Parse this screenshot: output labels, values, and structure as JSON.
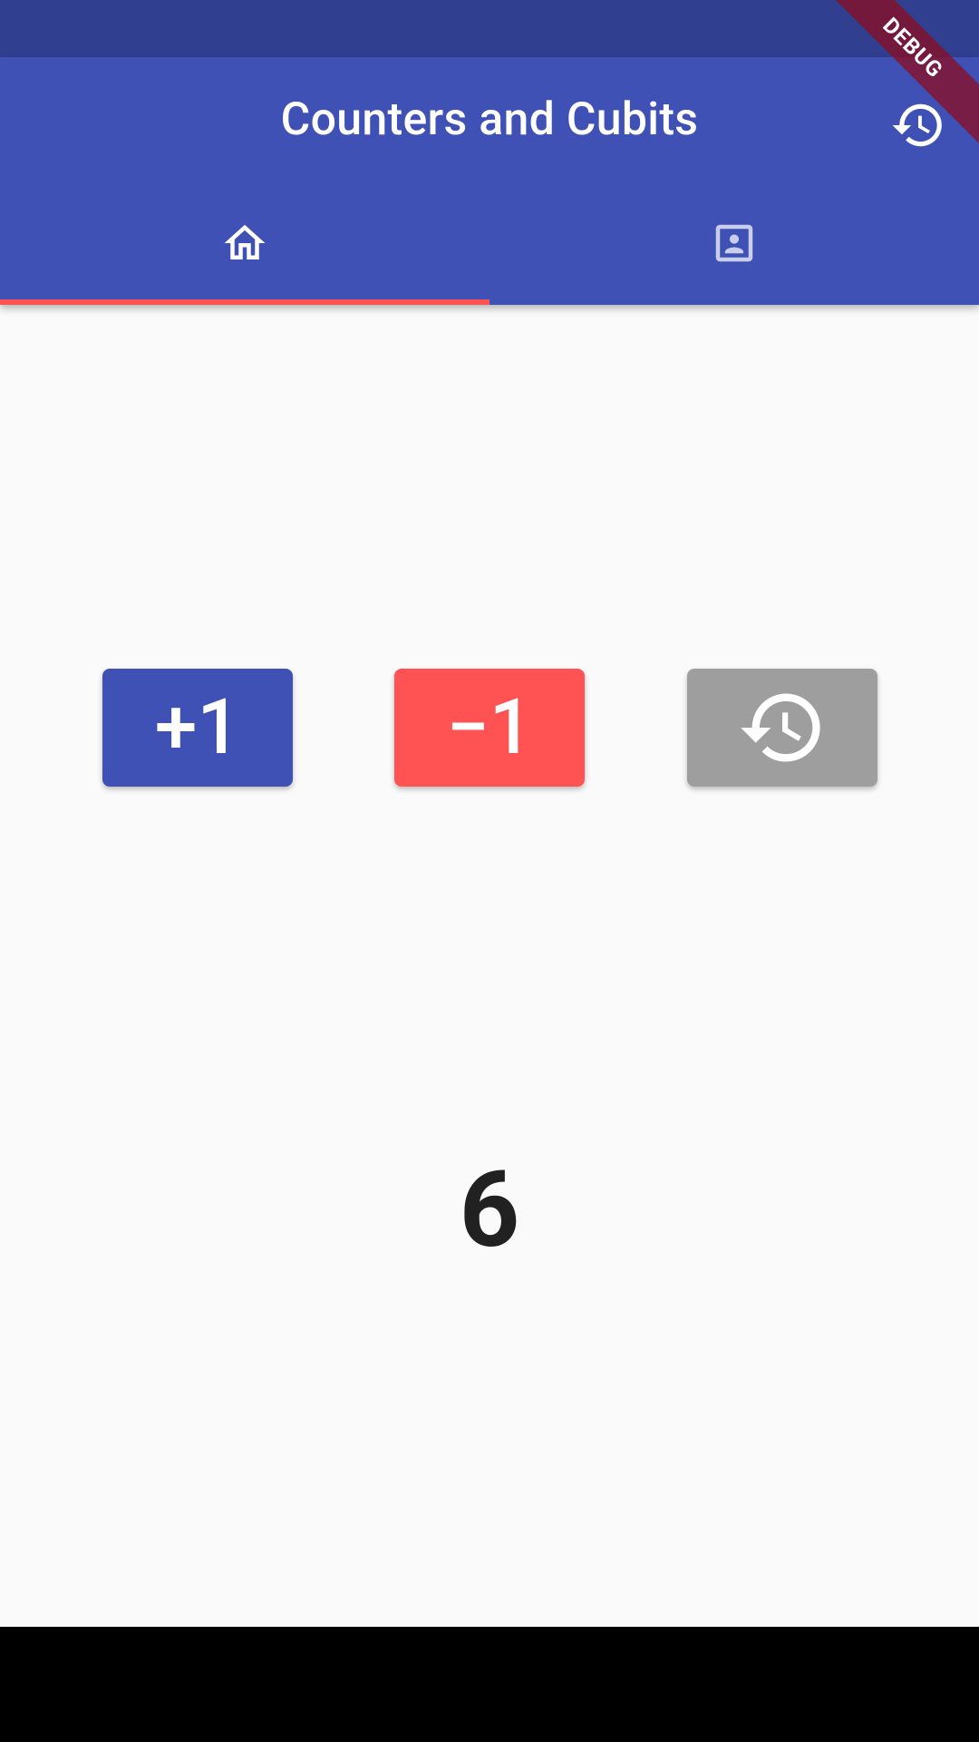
{
  "app_bar": {
    "title": "Counters and Cubits",
    "action_icon": "history-icon"
  },
  "tabs": [
    {
      "icon": "home-icon",
      "selected": true
    },
    {
      "icon": "portrait-icon",
      "selected": false
    }
  ],
  "buttons": {
    "increment": {
      "label": "+1",
      "color": "#3f51b5"
    },
    "decrement": {
      "label": "−1",
      "color": "#ff5252"
    },
    "reset": {
      "icon": "history-icon",
      "color": "#9e9e9e"
    }
  },
  "counter": {
    "value": "6"
  },
  "debug_banner": {
    "label": "DEBUG"
  },
  "colors": {
    "primary": "#3f51b5",
    "primary_dark": "#303f8f",
    "accent": "#ff5252",
    "background": "#fafafa"
  }
}
